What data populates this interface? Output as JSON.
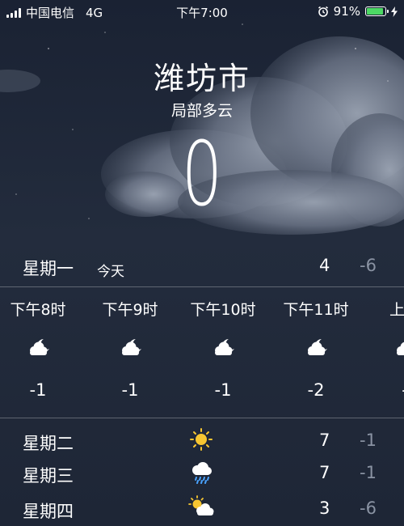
{
  "status_bar": {
    "carrier": "中国电信",
    "network": "4G",
    "time": "下午7:00",
    "battery_percent": "91%",
    "battery_level": 0.91,
    "battery_color": "#4cd964"
  },
  "location": {
    "city": "潍坊市",
    "condition": "局部多云",
    "temperature": "0"
  },
  "today": {
    "day": "星期一",
    "tag": "今天",
    "high": "4",
    "low": "-6"
  },
  "hourly": [
    {
      "time": "下午8时",
      "icon": "partly-cloudy-night-icon",
      "temp": "-1"
    },
    {
      "time": "下午9时",
      "icon": "partly-cloudy-night-icon",
      "temp": "-1"
    },
    {
      "time": "下午10时",
      "icon": "partly-cloudy-night-icon",
      "temp": "-1"
    },
    {
      "time": "下午11时",
      "icon": "partly-cloudy-night-icon",
      "temp": "-2"
    },
    {
      "time": "上午",
      "icon": "partly-cloudy-night-icon",
      "temp": "-"
    }
  ],
  "daily": [
    {
      "day": "星期二",
      "icon": "sunny-icon",
      "high": "7",
      "low": "-1"
    },
    {
      "day": "星期三",
      "icon": "rain-cloud-icon",
      "high": "7",
      "low": "-1"
    },
    {
      "day": "星期四",
      "icon": "partly-cloudy-day-icon",
      "high": "3",
      "low": "-6"
    }
  ]
}
